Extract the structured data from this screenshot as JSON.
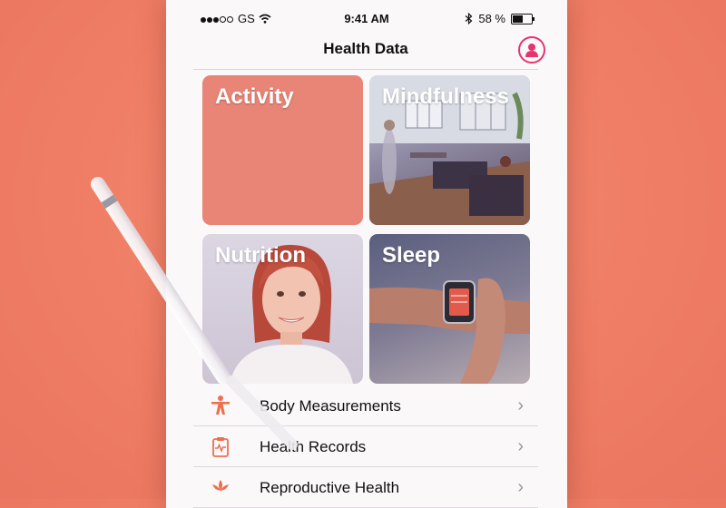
{
  "status_bar": {
    "carrier": "GS",
    "time": "9:41 AM",
    "battery": "58 %"
  },
  "header": {
    "title": "Health Data",
    "profile_icon": "person-circle-icon"
  },
  "tiles": [
    {
      "label": "Activity"
    },
    {
      "label": "Mindfulness"
    },
    {
      "label": "Nutrition"
    },
    {
      "label": "Sleep"
    }
  ],
  "list": [
    {
      "label": "Body Measurements",
      "icon": "body-figure-icon"
    },
    {
      "label": "Health Records",
      "icon": "clipboard-heartbeat-icon"
    },
    {
      "label": "Reproductive Health",
      "icon": "lotus-icon"
    }
  ],
  "colors": {
    "background": "#ef7c64",
    "accent": "#e8336e",
    "activity_tile": "#e98576",
    "list_icon": "#ee6e4e"
  }
}
